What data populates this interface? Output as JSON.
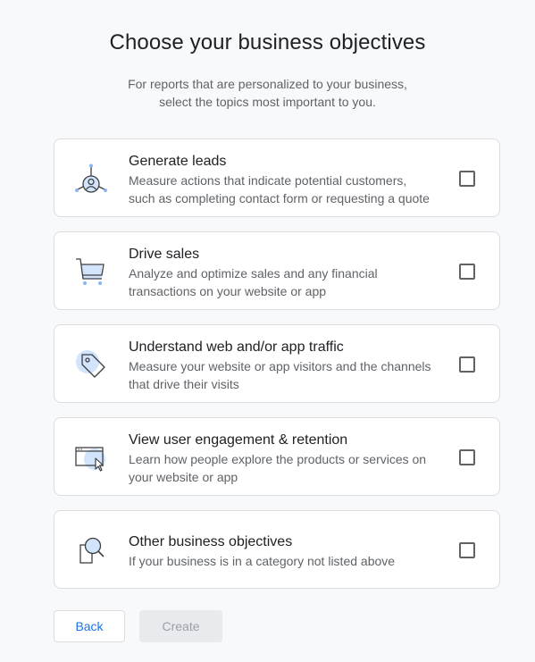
{
  "header": {
    "title": "Choose your business objectives",
    "subtitle_line1": "For reports that are personalized to your business,",
    "subtitle_line2": "select the topics most important to you."
  },
  "objectives": [
    {
      "icon": "leads-person-icon",
      "title": "Generate leads",
      "description_line1": "Measure actions that indicate potential customers,",
      "description_line2": "such as completing contact form or requesting a quote",
      "checked": false
    },
    {
      "icon": "shopping-cart-icon",
      "title": "Drive sales",
      "description_line1": "Analyze and optimize sales and any financial",
      "description_line2": "transactions on your website or app",
      "checked": false
    },
    {
      "icon": "price-tag-icon",
      "title": "Understand web and/or app traffic",
      "description_line1": "Measure your website or app visitors and the channels",
      "description_line2": "that drive their visits",
      "checked": false
    },
    {
      "icon": "browser-cursor-icon",
      "title": "View user engagement & retention",
      "description_line1": "Learn how people explore the products or services on",
      "description_line2": "your website or app",
      "checked": false
    },
    {
      "icon": "magnifier-document-icon",
      "title": "Other business objectives",
      "description_line1": "If your business is in a category not listed above",
      "checked": false
    }
  ],
  "actions": {
    "back_label": "Back",
    "create_label": "Create",
    "create_enabled": false
  },
  "colors": {
    "accent": "#1a73e8",
    "icon_highlight": "#d2e3fc",
    "icon_stroke": "#3c4043",
    "border": "#dadce0",
    "text_secondary": "#5f6368"
  }
}
